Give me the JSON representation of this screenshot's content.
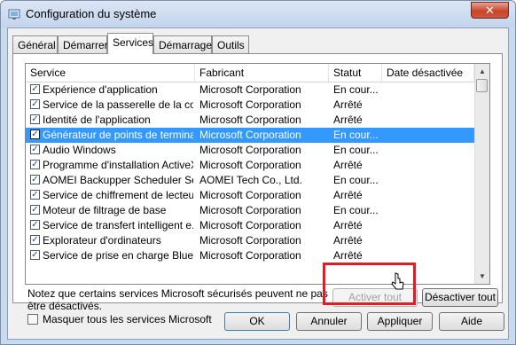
{
  "window": {
    "title": "Configuration du système",
    "close": "✕"
  },
  "tabs": [
    "Général",
    "Démarrer",
    "Services",
    "Démarrage",
    "Outils"
  ],
  "columns": [
    "Service",
    "Fabricant",
    "Statut",
    "Date désactivée"
  ],
  "rows": [
    {
      "service": "Expérience d'application",
      "maker": "Microsoft Corporation",
      "status": "En cour..."
    },
    {
      "service": "Service de la passerelle de la co...",
      "maker": "Microsoft Corporation",
      "status": "Arrêté"
    },
    {
      "service": "Identité de l'application",
      "maker": "Microsoft Corporation",
      "status": "Arrêté"
    },
    {
      "service": "Générateur de points de termina...",
      "maker": "Microsoft Corporation",
      "status": "En cour...",
      "selected": true
    },
    {
      "service": "Audio Windows",
      "maker": "Microsoft Corporation",
      "status": "En cour..."
    },
    {
      "service": "Programme d'installation ActiveX...",
      "maker": "Microsoft Corporation",
      "status": "Arrêté"
    },
    {
      "service": "AOMEI Backupper Scheduler Ser...",
      "maker": "AOMEI Tech Co., Ltd.",
      "status": "En cour..."
    },
    {
      "service": "Service de chiffrement de lecteu...",
      "maker": "Microsoft Corporation",
      "status": "Arrêté"
    },
    {
      "service": "Moteur de filtrage de base",
      "maker": "Microsoft Corporation",
      "status": "En cour..."
    },
    {
      "service": "Service de transfert intelligent e...",
      "maker": "Microsoft Corporation",
      "status": "Arrêté"
    },
    {
      "service": "Explorateur d'ordinateurs",
      "maker": "Microsoft Corporation",
      "status": "Arrêté"
    },
    {
      "service": "Service de prise en charge Bluet...",
      "maker": "Microsoft Corporation",
      "status": "Arrêté"
    }
  ],
  "note": "Notez que certains services Microsoft sécurisés peuvent ne pas être désactivés.",
  "enable_all": "Activer tout",
  "disable_all": "Désactiver tout",
  "hide_ms": "Masquer tous les services Microsoft",
  "buttons": {
    "ok": "OK",
    "cancel": "Annuler",
    "apply": "Appliquer",
    "help": "Aide"
  },
  "check_mark": "✓"
}
